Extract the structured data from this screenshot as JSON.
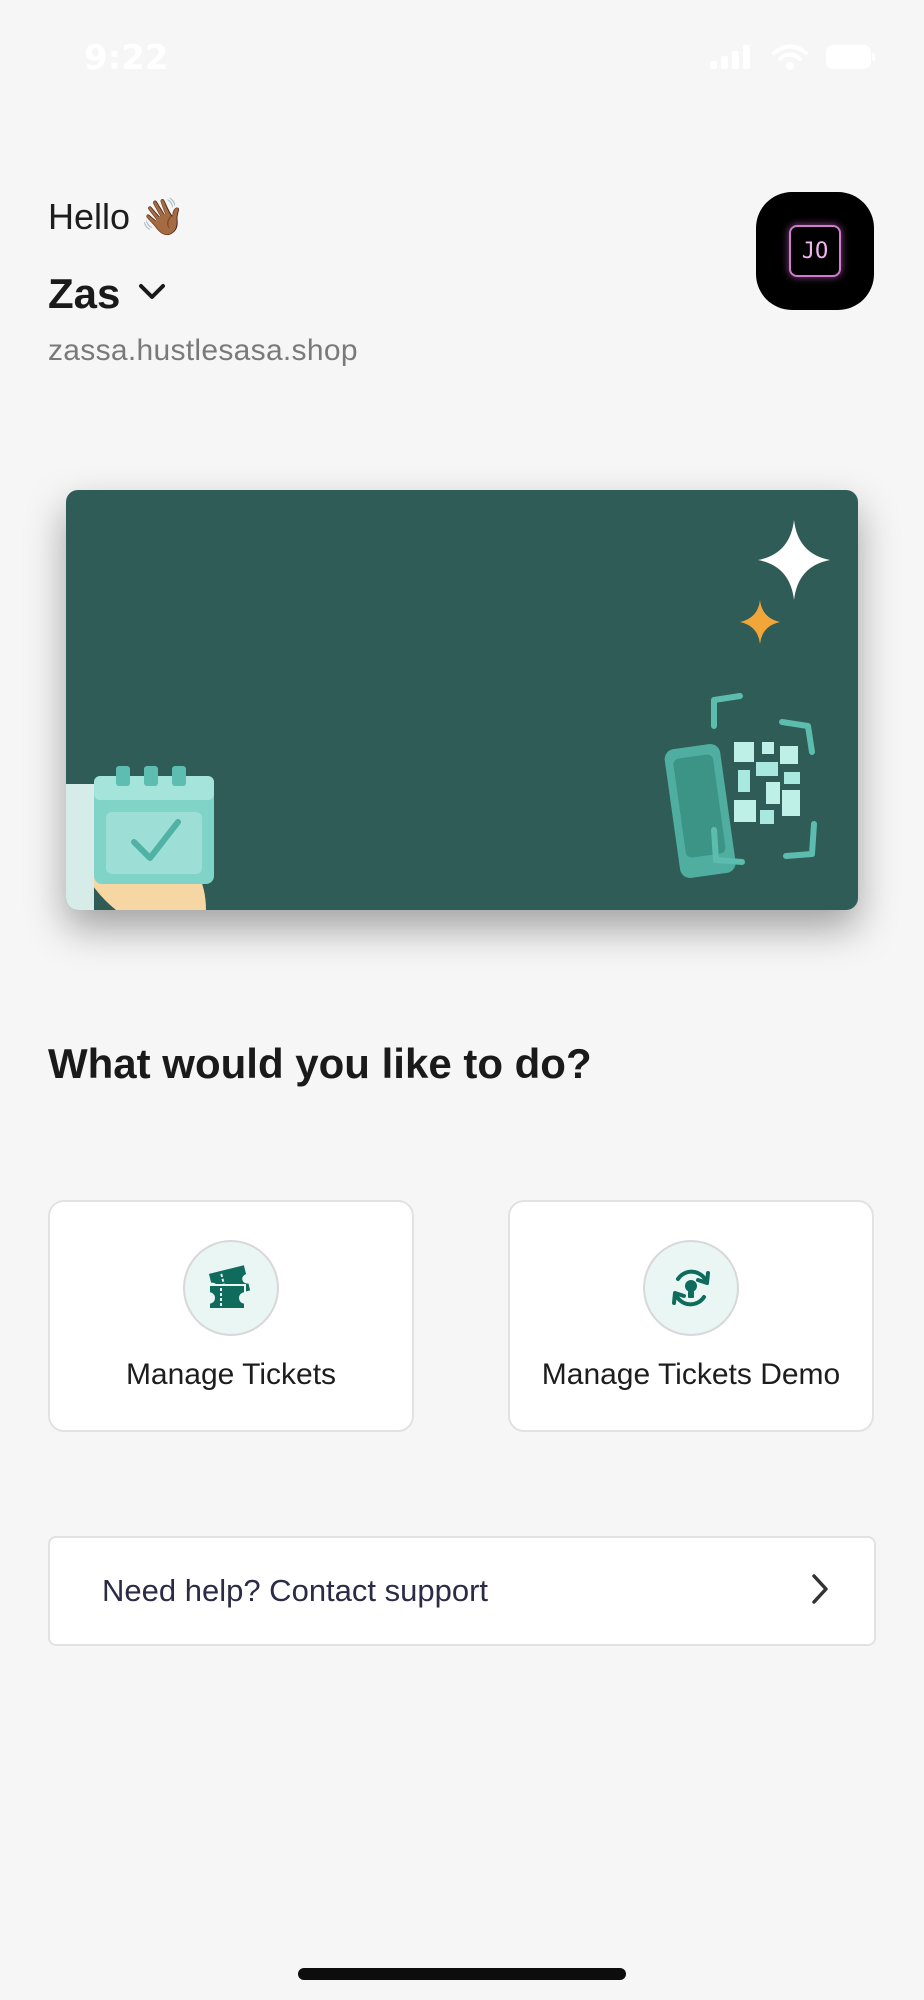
{
  "status_bar": {
    "time": "9:22",
    "icons": [
      "signal-icon",
      "wifi-icon",
      "battery-icon"
    ]
  },
  "header": {
    "greeting": "Hello",
    "greeting_emoji": "👋🏾",
    "store_name": "Zas",
    "store_url": "zassa.hustlesasa.shop",
    "avatar_initials": "JO"
  },
  "banner": {
    "background_color": "#2f5c56",
    "illustrations": [
      "calendar-check-icon",
      "phone-qr-code-icon",
      "sparkle-icon"
    ]
  },
  "section": {
    "title": "What would you like to do?"
  },
  "actions": [
    {
      "label": "Manage Tickets",
      "icon": "tickets-icon"
    },
    {
      "label": "Manage Tickets Demo",
      "icon": "refresh-bulb-icon"
    }
  ],
  "support": {
    "label": "Need help? Contact support"
  },
  "colors": {
    "background": "#f6f6f6",
    "accent": "#0f6b5c",
    "icon_bg": "#e9f6f3"
  }
}
